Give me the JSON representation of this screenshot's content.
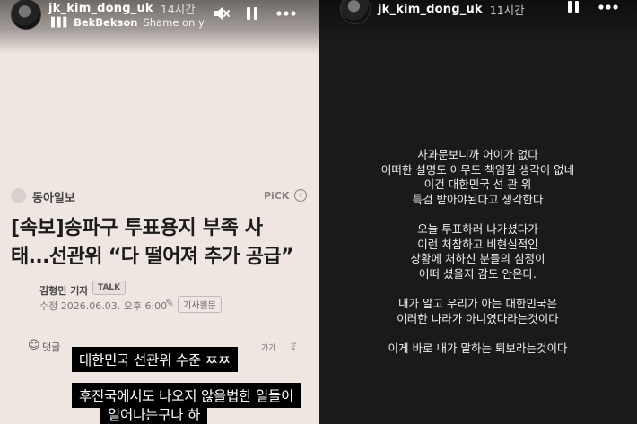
{
  "left_story": {
    "username": "jk_kim_dong_uk",
    "time": "14시간",
    "music": {
      "bars_icon": "waveform-icon",
      "artist": "BekBekson",
      "song": "Shame on you"
    },
    "controls": [
      "mute-icon",
      "pause-icon",
      "more-icon"
    ],
    "article": {
      "publisher": "동아일보",
      "pick_label": "PiCK",
      "headline_line1": "[속보]송파구 투표용지 부족 사",
      "headline_line2": "태...선관위 “다 떨어져 추가 공급”",
      "reporter": "김형민 기자",
      "talk_badge": "TALK",
      "revised": "수정 2026.06.03. 오후 6:00",
      "original_label": "기사원문",
      "comment_label": "댓글",
      "font_size_label": "가가"
    },
    "captions": [
      "대한민국 선관위 수준 ㅉㅉ",
      "후진국에서도 나오지 않을법한 일들이",
      "일어나는구나 하"
    ]
  },
  "right_story": {
    "username": "jk_kim_dong_uk",
    "time": "11시간",
    "controls": [
      "pause-icon",
      "more-icon"
    ],
    "lines": [
      "사과문보니까 어이가 없다",
      "어떠한 설명도 아무도 책임질 생각이 없네",
      "이건 대한민국 선 관 위",
      "특검 받아야된다고 생각한다",
      "",
      "오늘 투표하러 나가셨다가",
      "이런 처참하고 비현실적인",
      "상황에 처하신 분들의 심정이",
      "어떠 셨을지 감도 안온다.",
      "",
      "내가 알고 우리가 아는 대한민국은",
      "이러한 나라가 아니였다라는것이다",
      "",
      "이게 바로 내가 말하는 퇴보라는것이다"
    ]
  }
}
